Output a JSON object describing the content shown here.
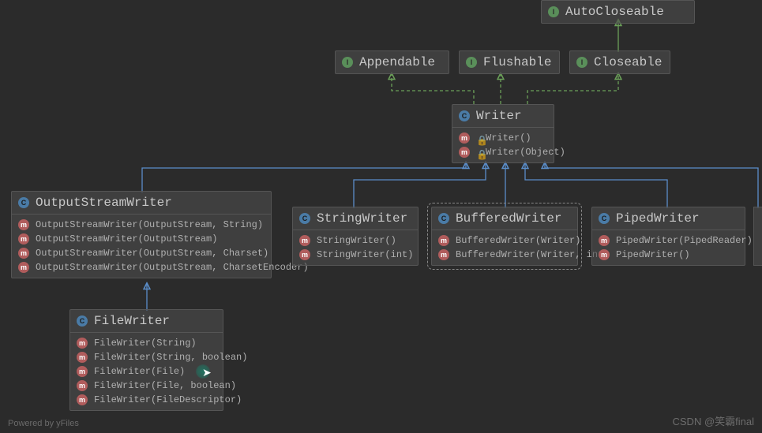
{
  "watermark_left": "Powered by yFiles",
  "watermark_right": "CSDN @笑霸final",
  "nodes": {
    "autocloseable": {
      "type": "interface",
      "title": "AutoCloseable"
    },
    "appendable": {
      "type": "interface",
      "title": "Appendable"
    },
    "flushable": {
      "type": "interface",
      "title": "Flushable"
    },
    "closeable": {
      "type": "interface",
      "title": "Closeable"
    },
    "writer": {
      "type": "class",
      "title": "Writer",
      "members": [
        "Writer()",
        "Writer(Object)"
      ]
    },
    "outputstreamwriter": {
      "type": "class",
      "title": "OutputStreamWriter",
      "members": [
        "OutputStreamWriter(OutputStream, String)",
        "OutputStreamWriter(OutputStream)",
        "OutputStreamWriter(OutputStream, Charset)",
        "OutputStreamWriter(OutputStream, CharsetEncoder)"
      ]
    },
    "stringwriter": {
      "type": "class",
      "title": "StringWriter",
      "members": [
        "StringWriter()",
        "StringWriter(int)"
      ]
    },
    "bufferedwriter": {
      "type": "class",
      "title": "BufferedWriter",
      "members": [
        "BufferedWriter(Writer)",
        "BufferedWriter(Writer, int)"
      ]
    },
    "pipedwriter": {
      "type": "class",
      "title": "PipedWriter",
      "members": [
        "PipedWriter(PipedReader)",
        "PipedWriter()"
      ]
    },
    "filewriter": {
      "type": "class",
      "title": "FileWriter",
      "members": [
        "FileWriter(String)",
        "FileWriter(String, boolean)",
        "FileWriter(File)",
        "FileWriter(File, boolean)",
        "FileWriter(FileDescriptor)"
      ]
    }
  }
}
